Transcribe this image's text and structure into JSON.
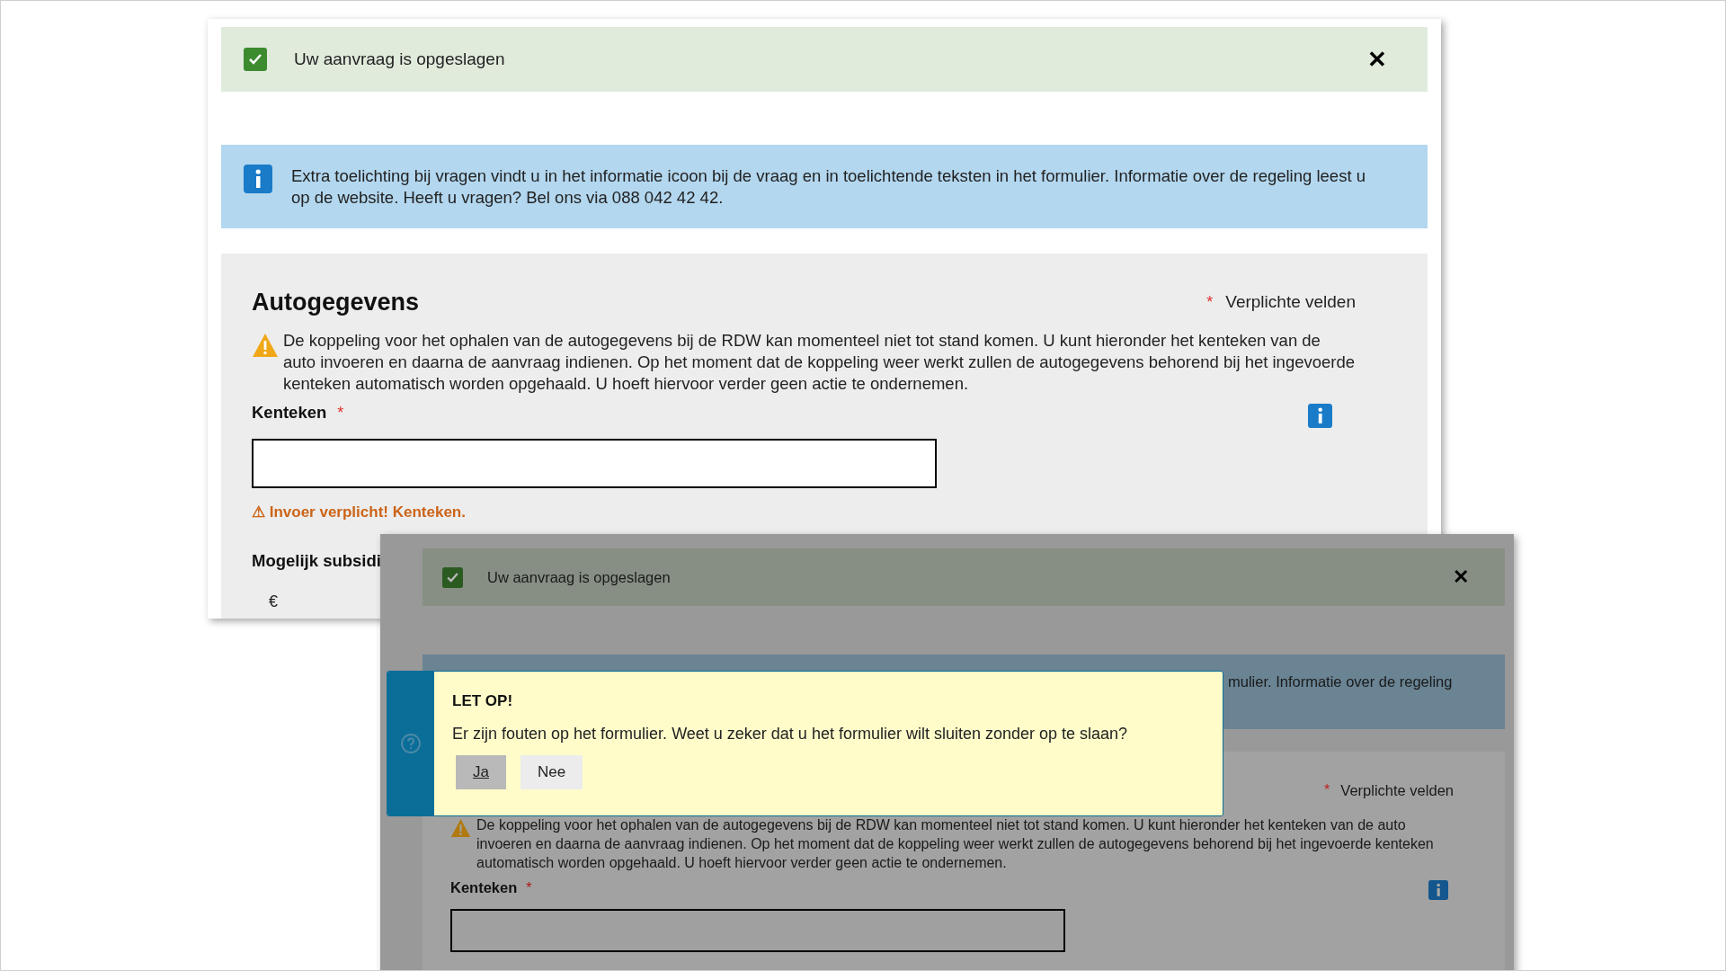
{
  "screenshot_1": {
    "notification": {
      "text": "Uw aanvraag is opgeslagen",
      "close": "✕"
    },
    "info": {
      "text": "Extra toelichting bij vragen vindt u in het informatie icoon bij de vraag en in toelichtende teksten in het formulier. Informatie over de regeling leest u op de website. Heeft u vragen? Bel ons via 088 042 42 42."
    },
    "section": {
      "title": "Autogegevens",
      "required_note": {
        "mark": "*",
        "text": "Verplichte velden"
      },
      "warning": "De koppeling voor het ophalen van de autogegevens bij de RDW  kan momenteel niet tot stand komen. U kunt hieronder het kenteken van de auto invoeren en daarna de aanvraag indienen. Op het moment dat de koppeling weer werkt zullen de autogegevens behorend bij het ingevoerde kenteken automatisch worden opgehaald. U hoeft hiervoor verder geen actie te ondernemen.",
      "field": {
        "label": "Kenteken",
        "required_mark": "*"
      },
      "error": "⚠ Invoer verplicht! Kenteken.",
      "field_2": {
        "label": "Mogelijk subsidi"
      },
      "currency": "€"
    }
  },
  "screenshot_2": {
    "notification": {
      "text": "Uw aanvraag is opgeslagen",
      "close": "✕"
    },
    "info": {
      "text": "mulier. Informatie over de regeling"
    },
    "section": {
      "required_note": {
        "mark": "*",
        "text": "Verplichte velden"
      },
      "warning": "De koppeling voor het ophalen van de autogegevens bij de RDW  kan momenteel niet tot stand komen. U kunt hieronder het kenteken van de auto invoeren en daarna de aanvraag indienen. Op het moment dat de koppeling weer werkt zullen de autogegevens behorend bij het ingevoerde kenteken automatisch worden opgehaald. U hoeft hiervoor verder geen actie te ondernemen.",
      "field": {
        "label": "Kenteken",
        "required_mark": "*"
      }
    },
    "dialog": {
      "title": "LET OP!",
      "message": "Er zijn fouten op het formulier. Weet u zeker dat u het formulier wilt sluiten zonder op te slaan?",
      "buttons": [
        {
          "label": "Ja",
          "focused": true
        },
        {
          "label": "Nee",
          "focused": false
        }
      ]
    }
  }
}
